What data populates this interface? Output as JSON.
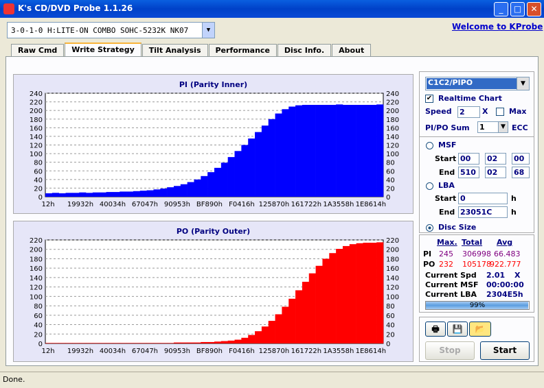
{
  "window": {
    "title": "K's CD/DVD Probe 1.1.26",
    "min": "_",
    "max": "□",
    "close": "✕"
  },
  "drive": {
    "selected": "3-0-1-0 H:LITE-ON COMBO SOHC-5232K NK07"
  },
  "welcome_link": "Welcome to KProbe",
  "tabs": [
    "Raw Cmd",
    "Write Strategy",
    "Tilt Analysis",
    "Performance",
    "Disc Info.",
    "About"
  ],
  "side": {
    "mode": "C1C2/PIPO",
    "realtime_label": "Realtime Chart",
    "realtime_checked": true,
    "speed_label": "Speed",
    "speed": "2",
    "x": "X",
    "max_label": "Max",
    "sum_label": "PI/PO Sum",
    "sum": "1",
    "ecc": "ECC",
    "msf_label": "MSF",
    "start_label": "Start",
    "end_label": "End",
    "msf_start": [
      "00",
      "02",
      "00"
    ],
    "msf_end": [
      "510",
      "02",
      "68"
    ],
    "lba_label": "LBA",
    "lba_start": "0",
    "lba_end": "23051C",
    "h": "h",
    "disc_size_label": "Disc Size"
  },
  "stats": {
    "headers": [
      "Max.",
      "Total",
      "Avg"
    ],
    "pi": {
      "label": "PI",
      "max": "245",
      "total": "306998",
      "avg": "66.483"
    },
    "po": {
      "label": "PO",
      "max": "232",
      "total": "105178",
      "avg": "922.777"
    },
    "cur_spd_label": "Current Spd",
    "cur_spd": "2.01",
    "cur_spd_unit": "X",
    "cur_msf_label": "Current MSF",
    "cur_msf": "00:00:00",
    "cur_lba_label": "Current LBA",
    "cur_lba": "2304E5h",
    "progress": 99,
    "progress_label": "99%"
  },
  "buttons": {
    "stop": "Stop",
    "start": "Start",
    "print": "print",
    "save": "save",
    "open": "open"
  },
  "status": "Done.",
  "chart_data": [
    {
      "type": "bar",
      "title": "PI (Parity Inner)",
      "ylim": [
        0,
        240
      ],
      "yticks": [
        0,
        20,
        40,
        60,
        80,
        100,
        120,
        140,
        160,
        180,
        200,
        220,
        240
      ],
      "xticks": [
        "12h",
        "19932h",
        "40034h",
        "67047h",
        "90953h",
        "BF890h",
        "F0416h",
        "125870h",
        "161722h",
        "1A3558h",
        "1E8614h"
      ],
      "color": "#0000ff",
      "values": [
        8,
        9,
        8,
        9,
        9,
        10,
        9,
        10,
        10,
        11,
        11,
        12,
        12,
        13,
        14,
        15,
        17,
        19,
        22,
        25,
        29,
        34,
        40,
        48,
        57,
        67,
        79,
        92,
        106,
        120,
        135,
        150,
        165,
        180,
        193,
        203,
        209,
        212,
        213,
        213,
        213,
        213,
        213,
        214,
        213,
        213,
        213,
        213,
        213,
        214
      ]
    },
    {
      "type": "bar",
      "title": "PO (Parity Outer)",
      "ylim": [
        0,
        220
      ],
      "yticks": [
        0,
        20,
        40,
        60,
        80,
        100,
        120,
        140,
        160,
        180,
        200,
        220
      ],
      "xticks": [
        "12h",
        "19932h",
        "40034h",
        "67047h",
        "90953h",
        "BF890h",
        "F0416h",
        "125870h",
        "161722h",
        "1A3558h",
        "1E8614h"
      ],
      "color": "#ff0000",
      "values": [
        1,
        1,
        1,
        1,
        1,
        1,
        1,
        1,
        1,
        1,
        1,
        1,
        1,
        1,
        1,
        1,
        1,
        1,
        1,
        2,
        2,
        2,
        2,
        3,
        3,
        4,
        5,
        6,
        8,
        12,
        18,
        26,
        36,
        48,
        62,
        78,
        95,
        113,
        131,
        149,
        165,
        180,
        192,
        201,
        207,
        211,
        213,
        214,
        214,
        215
      ]
    }
  ]
}
